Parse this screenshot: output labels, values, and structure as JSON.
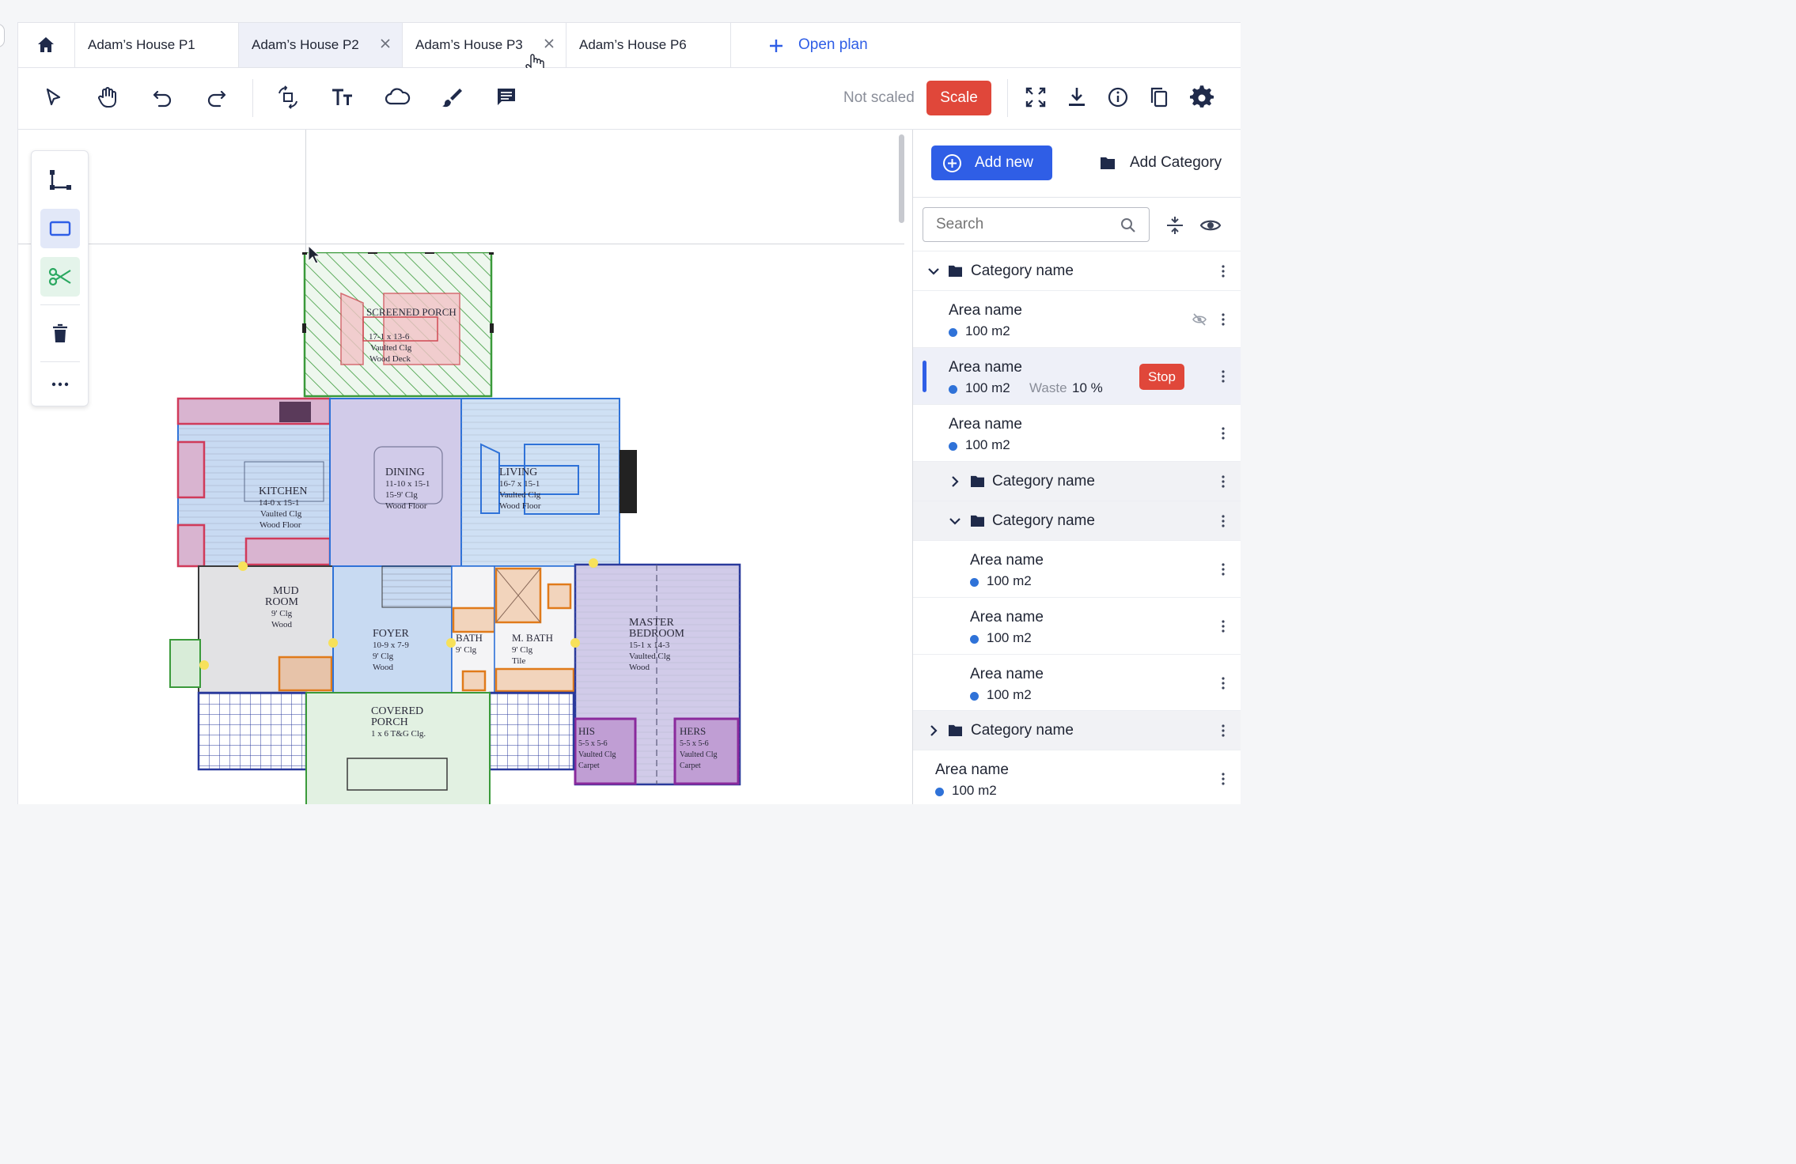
{
  "tabs": [
    {
      "label": "Adam’s House P1",
      "active": false,
      "closable": false
    },
    {
      "label": "Adam’s House P2",
      "active": true,
      "closable": true
    },
    {
      "label": "Adam’s House P3",
      "active": false,
      "closable": true
    },
    {
      "label": "Adam’s House P6",
      "active": false,
      "closable": false
    }
  ],
  "open_plan_label": "Open plan",
  "toolbar": {
    "tools": [
      "select-icon",
      "hand-icon",
      "undo-icon",
      "redo-icon",
      "rotate-icon",
      "text-icon",
      "cloud-icon",
      "brush-icon",
      "comment-icon"
    ],
    "scale_status": "Not scaled",
    "scale_label": "Scale",
    "right_tools": [
      "fullscreen-icon",
      "download-icon",
      "info-icon",
      "copy-icon",
      "settings-icon"
    ]
  },
  "left_tools": [
    "polyline-icon",
    "rectangle-icon",
    "scissors-icon",
    "trash-icon",
    "more-icon"
  ],
  "plan_labels": {
    "porch": "SCREENED PORCH",
    "porch_dim": "17-1 x 13-6",
    "porch_clg": "Vaulted Clg",
    "porch_floor": "Wood Deck",
    "kitchen": "KITCHEN",
    "kitchen_dim": "14-0 x 15-1",
    "kitchen_clg": "Vaulted Clg",
    "kitchen_floor": "Wood Floor",
    "dining": "DINING",
    "dining_dim": "11-10 x 15-1",
    "dining_clg": "15-9' Clg",
    "dining_floor": "Wood Floor",
    "living": "LIVING",
    "living_dim": "16-7 x 15-1",
    "living_clg": "Vaulted Clg",
    "living_floor": "Wood Floor",
    "mud": "MUD",
    "mud2": "ROOM",
    "mud_clg": "9' Clg",
    "mud_floor": "Wood",
    "foyer": "FOYER",
    "foyer_dim": "10-9 x 7-9",
    "foyer_clg": "9' Clg",
    "foyer_floor": "Wood",
    "bath": "BATH",
    "bath_clg": "9' Clg",
    "mbath": "M. BATH",
    "mbath_clg": "9' Clg",
    "mbath_floor": "Tile",
    "master": "MASTER",
    "master2": "BEDROOM",
    "master_dim": "15-1 x 14-3",
    "master_clg": "Vaulted Clg",
    "master_floor": "Wood",
    "covered": "COVERED",
    "covered2": "PORCH",
    "covered_clg": "1 x 6 T&G Clg.",
    "his": "HIS",
    "his_dim": "5-5 x 5-6",
    "his_clg": "Vaulted Clg",
    "his_floor": "Carpet",
    "hers": "HERS",
    "hers_dim": "5-5 x 5-6",
    "hers_clg": "Vaulted Clg",
    "hers_floor": "Carpet"
  },
  "panel": {
    "add_new_label": "Add new",
    "add_category_label": "Add Category",
    "search_placeholder": "Search",
    "rows": [
      {
        "type": "category",
        "label": "Category name"
      },
      {
        "type": "area",
        "name": "Area name",
        "value": "100 m2"
      },
      {
        "type": "area",
        "name": "Area name",
        "value": "100 m2",
        "waste_label": "Waste",
        "waste_value": "10 %",
        "stop_label": "Stop"
      },
      {
        "type": "area",
        "name": "Area name",
        "value": "100 m2"
      },
      {
        "type": "category",
        "label": "Category name"
      },
      {
        "type": "category",
        "label": "Category name"
      },
      {
        "type": "area",
        "name": "Area name",
        "value": "100 m2"
      },
      {
        "type": "area",
        "name": "Area name",
        "value": "100 m2"
      },
      {
        "type": "area",
        "name": "Area name",
        "value": "100 m2"
      },
      {
        "type": "category",
        "label": "Category name"
      },
      {
        "type": "area",
        "name": "Area name",
        "value": "100 m2"
      }
    ]
  },
  "colors": {
    "accent": "#2f5ee6",
    "danger": "#e0473a",
    "area_dot": "#2f72d8"
  }
}
